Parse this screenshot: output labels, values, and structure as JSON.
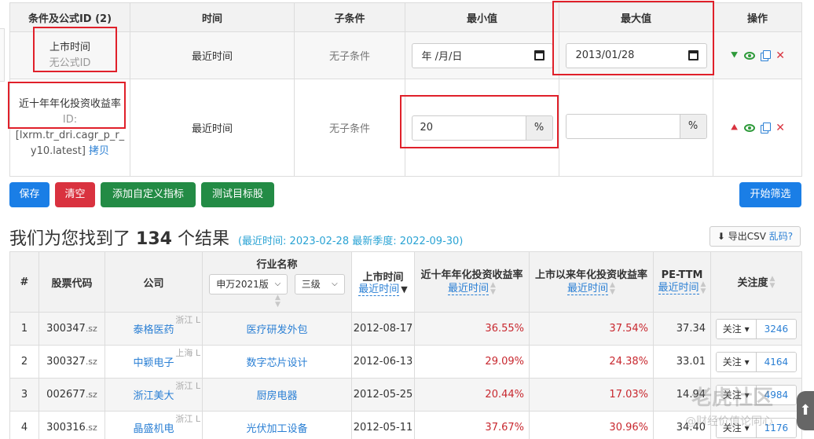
{
  "conditions": {
    "headers": [
      "条件及公式ID (2)",
      "时间",
      "子条件",
      "最小值",
      "最大值",
      "操作"
    ],
    "rows": [
      {
        "name": "上市时间",
        "id_line": "无公式ID",
        "id_value": "",
        "copy": "",
        "time": "最近时间",
        "sub": "无子条件",
        "min": "年 /月/日",
        "max": "2013/01/28",
        "type": "date"
      },
      {
        "name": "近十年年化投资收益率",
        "id_line": "ID:",
        "id_value": "[lxrm.tr_dri.cagr_p_r_y10.latest]",
        "copy": "拷贝",
        "time": "最近时间",
        "sub": "无子条件",
        "min": "20",
        "max": "",
        "unit": "%",
        "type": "pct"
      }
    ]
  },
  "buttons": {
    "save": "保存",
    "clear": "清空",
    "add_indicator": "添加自定义指标",
    "test_stock": "测试目标股",
    "start": "开始筛选"
  },
  "results": {
    "prefix": "我们为您找到了",
    "count": "134",
    "suffix": "个结果",
    "sub": "(最近时间: 2023-02-28 最新季度: 2022-09-30)",
    "export_label": "导出CSV",
    "export_q": "乱码?"
  },
  "table": {
    "headers": {
      "num": "#",
      "code": "股票代码",
      "company": "公司",
      "industry": "行业名称",
      "industry_sel1": "申万2021版",
      "industry_sel2": "三级",
      "listing": "上市时间",
      "listing_sub": "最近时间",
      "cagr10": "近十年年化投资收益率",
      "cagr10_sub": "最近时间",
      "cagr_all": "上市以来年化投资收益率",
      "cagr_all_sub": "最近时间",
      "pe": "PE-TTM",
      "pe_sub": "最近时间",
      "focus": "关注度"
    },
    "focus_btn": "关注",
    "rows": [
      {
        "num": "1",
        "code": "300347",
        "suffix": ".sz",
        "company": "泰格医药",
        "region": "浙江 L",
        "industry": "医疗研发外包",
        "listing": "2012-08-17",
        "cagr10": "36.55%",
        "cagr_all": "37.54%",
        "pe": "37.34",
        "focus": "3246"
      },
      {
        "num": "2",
        "code": "300327",
        "suffix": ".sz",
        "company": "中颖电子",
        "region": "上海 L",
        "industry": "数字芯片设计",
        "listing": "2012-06-13",
        "cagr10": "29.09%",
        "cagr_all": "24.38%",
        "pe": "33.01",
        "focus": "4164"
      },
      {
        "num": "3",
        "code": "002677",
        "suffix": ".sz",
        "company": "浙江美大",
        "region": "浙江 L",
        "industry": "厨房电器",
        "listing": "2012-05-25",
        "cagr10": "20.44%",
        "cagr_all": "17.03%",
        "pe": "14.94",
        "focus": "4984"
      },
      {
        "num": "4",
        "code": "300316",
        "suffix": ".sz",
        "company": "晶盛机电",
        "region": "浙江 L",
        "industry": "光伏加工设备",
        "listing": "2012-05-11",
        "cagr10": "37.67%",
        "cagr_all": "30.96%",
        "pe": "34.40",
        "focus": "1176"
      }
    ]
  },
  "watermark": {
    "main": "老虎社区",
    "sub": "@财经价值论同心"
  }
}
